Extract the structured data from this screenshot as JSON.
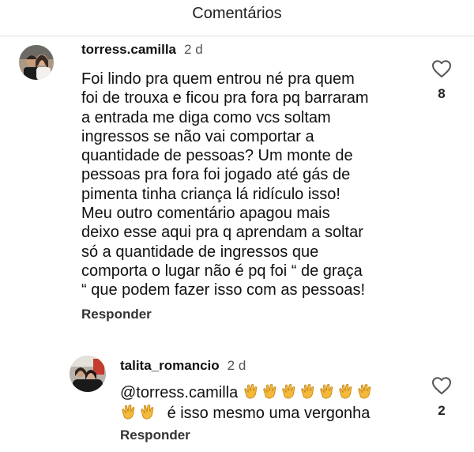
{
  "header": {
    "title": "Comentários"
  },
  "comments": [
    {
      "username": "torress.camilla",
      "time": "2 d",
      "lines": [
        "Foi lindo pra quem entrou né pra quem",
        "foi de trouxa e ficou pra fora pq barraram",
        "a entrada me diga como vcs soltam",
        "ingressos se não vai comportar a",
        "quantidade de pessoas? Um monte de",
        "pessoas pra fora foi jogado até gás de",
        "pimenta tinha criança lá ridículo isso!",
        "Meu outro comentário apagou mais",
        "deixo esse aqui pra q aprendam a soltar",
        "só a quantidade de ingressos que",
        "comporta o lugar não é pq foi “ de graça",
        "“ que podem fazer isso com as pessoas!"
      ],
      "reply_label": "Responder",
      "like_count": "8",
      "like_icon": "heart-outline-icon"
    },
    {
      "username": "talita_romancio",
      "time": "2 d",
      "mention": "@torress.camilla",
      "emoji": "clapping-hands",
      "text_after": "é isso mesmo uma vergonha",
      "reply_label": "Responder",
      "like_count": "2",
      "like_icon": "heart-outline-icon"
    }
  ]
}
